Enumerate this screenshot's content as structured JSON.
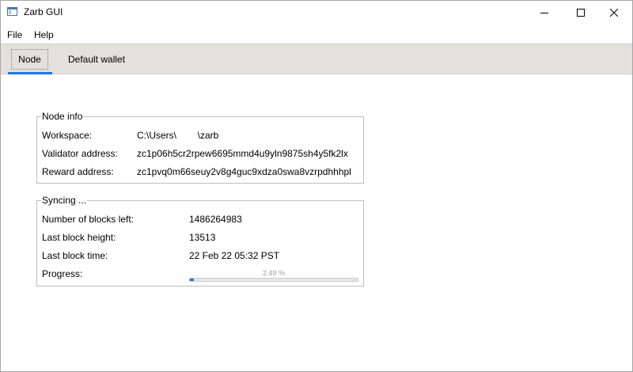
{
  "window": {
    "title": "Zarb GUI"
  },
  "menu": {
    "items": [
      "File",
      "Help"
    ]
  },
  "tabs": [
    "Node",
    "Default wallet"
  ],
  "node_info": {
    "title": "Node info",
    "rows": [
      {
        "label": "Workspace:",
        "value": "C:\\Users\\        \\zarb"
      },
      {
        "label": "Validator address:",
        "value": "zc1p06h5cr2rpew6695mmd4u9yln9875sh4y5fk2lx"
      },
      {
        "label": "Reward address:",
        "value": "zc1pvq0m66seuy2v8g4guc9xdza0swa8vzrpdhhhpl"
      }
    ]
  },
  "syncing": {
    "title": "Syncing ...",
    "rows": [
      {
        "label": "Number of blocks left:",
        "value": "1486264983"
      },
      {
        "label": "Last block height:",
        "value": "13513"
      },
      {
        "label": "Last block time:",
        "value": "22 Feb 22 05:32 PST"
      },
      {
        "label": "Progress:",
        "value": ""
      }
    ],
    "progress_percent": 2.49,
    "progress_text": "2.49 %"
  },
  "colors": {
    "accent": "#1e78d7"
  }
}
